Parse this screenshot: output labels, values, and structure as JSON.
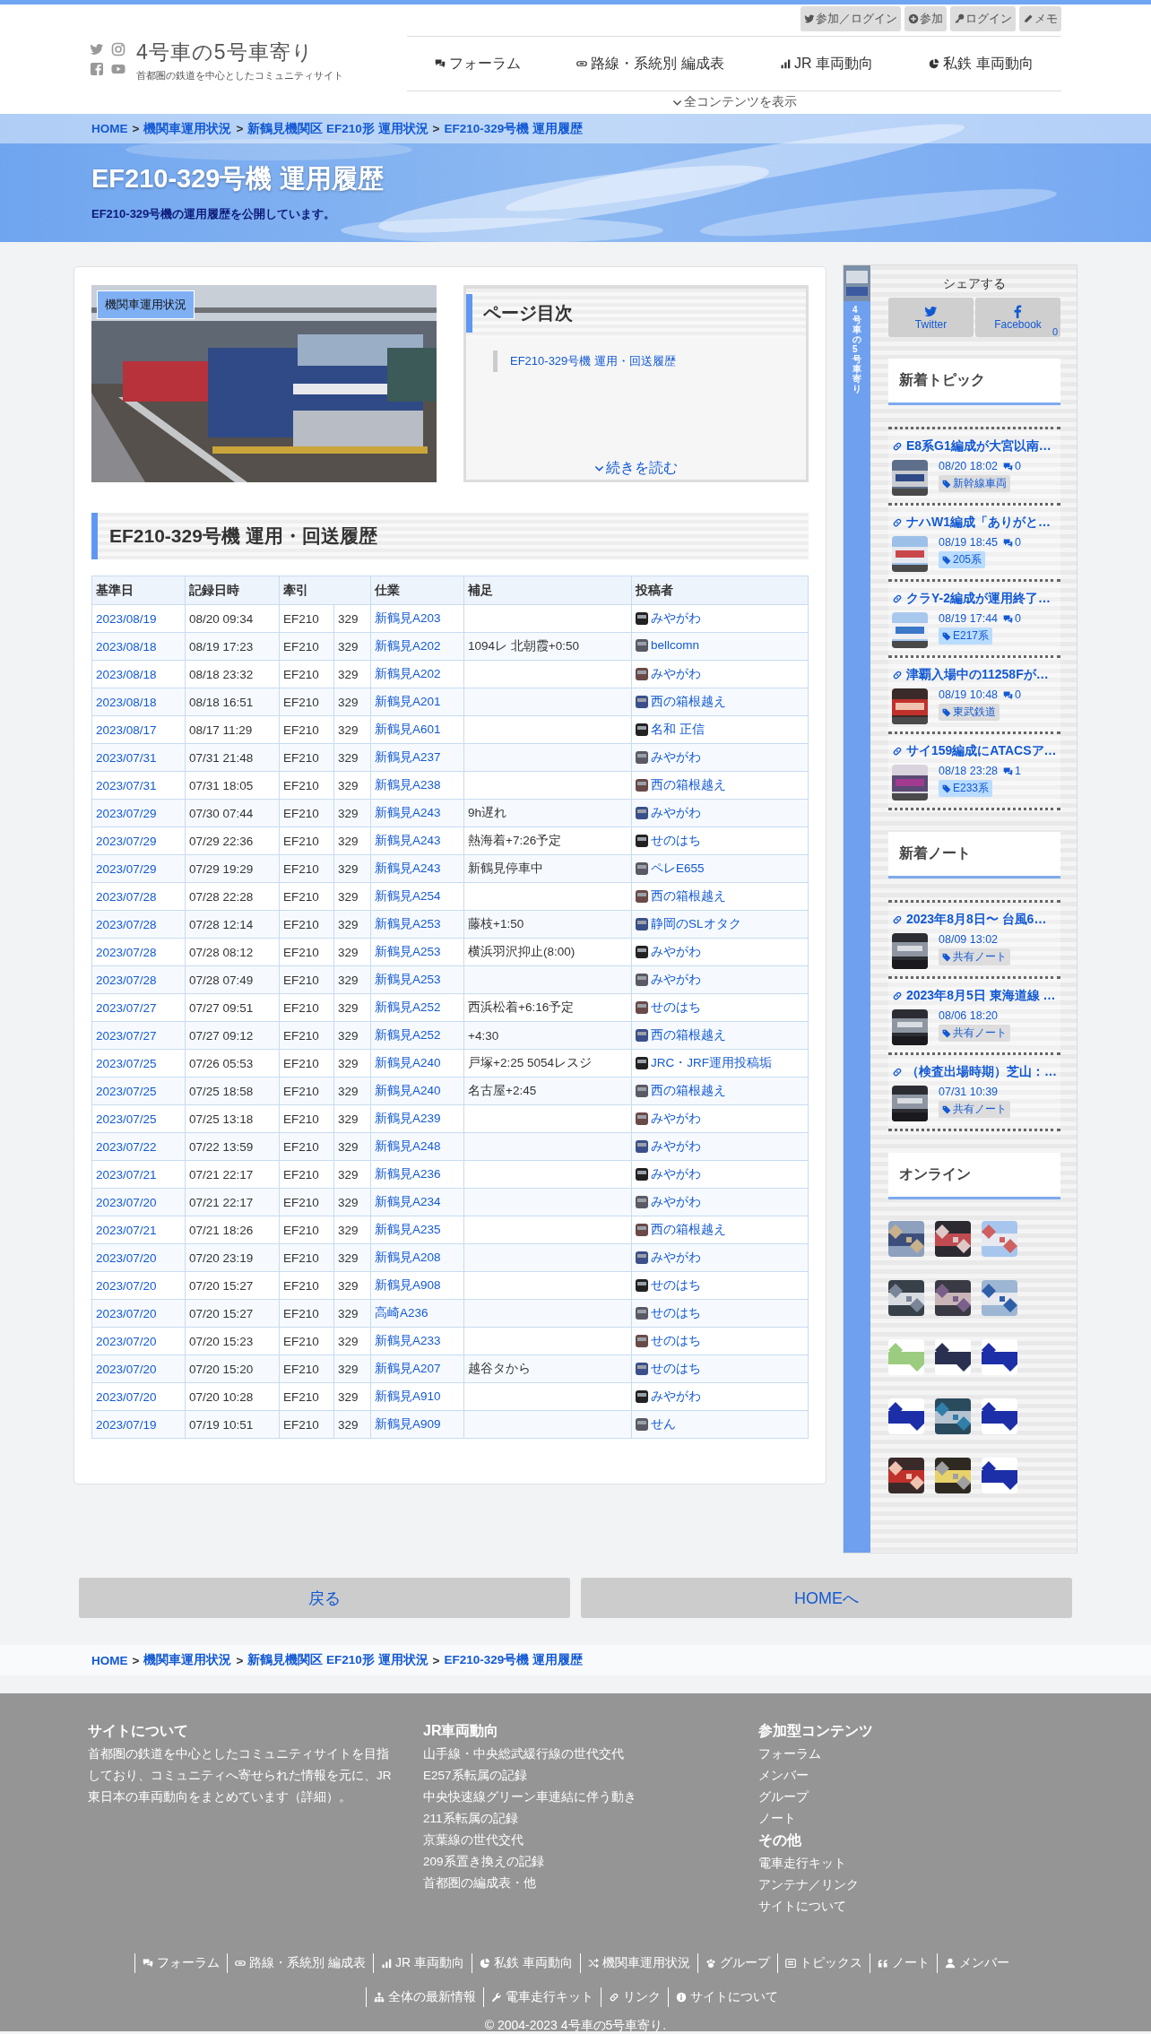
{
  "header": {
    "site_title": "4号車の5号車寄り",
    "tagline": "首都圏の鉄道を中心としたコミュニティサイト",
    "user_links": [
      "参加／ログイン",
      "参加",
      "ログイン",
      "メモ"
    ],
    "nav": [
      "フォーラム",
      "路線・系統別 編成表",
      "JR 車両動向",
      "私鉄 車両動向"
    ],
    "show_all": "全コンテンツを表示"
  },
  "breadcrumb": {
    "separator": ">",
    "items": [
      "HOME",
      "機関車運用状況",
      "新鶴見機関区 EF210形 運用状況",
      "EF210-329号機 運用履歴"
    ]
  },
  "hero": {
    "title": "EF210-329号機 運用履歴",
    "subtitle": "EF210-329号機の運用履歴を公開しています。"
  },
  "photo": {
    "kind": "picture",
    "tag": "機関車運用状況"
  },
  "toc": {
    "title": "ページ目次",
    "items": [
      "EF210-329号機 運用・回送履歴"
    ],
    "more": "続きを読む"
  },
  "section_title": "EF210-329号機 運用・回送履歴",
  "table": {
    "columns": [
      "基準日",
      "記録日時",
      "牽引",
      "仕業",
      "補足",
      "投稿者"
    ],
    "rows": [
      {
        "date": "2023/08/19",
        "recorded": "08/20 09:34",
        "loco": "EF210",
        "number": "329",
        "duty": "新鶴見A203",
        "poster": "みやがわ"
      },
      {
        "date": "2023/08/18",
        "recorded": "08/19 17:23",
        "loco": "EF210",
        "number": "329",
        "duty": "新鶴見A202",
        "note": "1094レ 北朝霞+0:50",
        "poster": "bellcomn"
      },
      {
        "date": "2023/08/18",
        "recorded": "08/18 23:32",
        "loco": "EF210",
        "number": "329",
        "duty": "新鶴見A202",
        "poster": "みやがわ"
      },
      {
        "date": "2023/08/18",
        "recorded": "08/18 16:51",
        "loco": "EF210",
        "number": "329",
        "duty": "新鶴見A201",
        "poster": "西の箱根越え"
      },
      {
        "date": "2023/08/17",
        "recorded": "08/17 11:29",
        "loco": "EF210",
        "number": "329",
        "duty": "新鶴見A601",
        "poster": "名和 正信"
      },
      {
        "date": "2023/07/31",
        "recorded": "07/31 21:48",
        "loco": "EF210",
        "number": "329",
        "duty": "新鶴見A237",
        "poster": "みやがわ"
      },
      {
        "date": "2023/07/31",
        "recorded": "07/31 18:05",
        "loco": "EF210",
        "number": "329",
        "duty": "新鶴見A238",
        "poster": "西の箱根越え"
      },
      {
        "date": "2023/07/29",
        "recorded": "07/30 07:44",
        "loco": "EF210",
        "number": "329",
        "duty": "新鶴見A243",
        "note": "9h遅れ",
        "poster": "みやがわ"
      },
      {
        "date": "2023/07/29",
        "recorded": "07/29 22:36",
        "loco": "EF210",
        "number": "329",
        "duty": "新鶴見A243",
        "note": "熱海着+7:26予定",
        "poster": "せのはち"
      },
      {
        "date": "2023/07/29",
        "recorded": "07/29 19:29",
        "loco": "EF210",
        "number": "329",
        "duty": "新鶴見A243",
        "note": "新鶴見停車中",
        "poster": "ペレE655"
      },
      {
        "date": "2023/07/28",
        "recorded": "07/28 22:28",
        "loco": "EF210",
        "number": "329",
        "duty": "新鶴見A254",
        "poster": "西の箱根越え"
      },
      {
        "date": "2023/07/28",
        "recorded": "07/28 12:14",
        "loco": "EF210",
        "number": "329",
        "duty": "新鶴見A253",
        "note": "藤枝+1:50",
        "poster": "静岡のSLオタク"
      },
      {
        "date": "2023/07/28",
        "recorded": "07/28 08:12",
        "loco": "EF210",
        "number": "329",
        "duty": "新鶴見A253",
        "note": "横浜羽沢抑止(8:00)",
        "poster": "みやがわ"
      },
      {
        "date": "2023/07/28",
        "recorded": "07/28 07:49",
        "loco": "EF210",
        "number": "329",
        "duty": "新鶴見A253",
        "poster": "みやがわ"
      },
      {
        "date": "2023/07/27",
        "recorded": "07/27 09:51",
        "loco": "EF210",
        "number": "329",
        "duty": "新鶴見A252",
        "note": "西浜松着+6:16予定",
        "poster": "せのはち"
      },
      {
        "date": "2023/07/27",
        "recorded": "07/27 09:12",
        "loco": "EF210",
        "number": "329",
        "duty": "新鶴見A252",
        "note": "+4:30",
        "poster": "西の箱根越え"
      },
      {
        "date": "2023/07/25",
        "recorded": "07/26 05:53",
        "loco": "EF210",
        "number": "329",
        "duty": "新鶴見A240",
        "note": "戸塚+2:25 5054レスジ",
        "poster": "JRC・JRF運用投稿垢"
      },
      {
        "date": "2023/07/25",
        "recorded": "07/25 18:58",
        "loco": "EF210",
        "number": "329",
        "duty": "新鶴見A240",
        "note": "名古屋+2:45",
        "poster": "西の箱根越え"
      },
      {
        "date": "2023/07/25",
        "recorded": "07/25 13:18",
        "loco": "EF210",
        "number": "329",
        "duty": "新鶴見A239",
        "poster": "みやがわ"
      },
      {
        "date": "2023/07/22",
        "recorded": "07/22 13:59",
        "loco": "EF210",
        "number": "329",
        "duty": "新鶴見A248",
        "poster": "みやがわ"
      },
      {
        "date": "2023/07/21",
        "recorded": "07/21 22:17",
        "loco": "EF210",
        "number": "329",
        "duty": "新鶴見A236",
        "poster": "みやがわ"
      },
      {
        "date": "2023/07/20",
        "recorded": "07/21 22:17",
        "loco": "EF210",
        "number": "329",
        "duty": "新鶴見A234",
        "poster": "みやがわ"
      },
      {
        "date": "2023/07/21",
        "recorded": "07/21 18:26",
        "loco": "EF210",
        "number": "329",
        "duty": "新鶴見A235",
        "poster": "西の箱根越え"
      },
      {
        "date": "2023/07/20",
        "recorded": "07/20 23:19",
        "loco": "EF210",
        "number": "329",
        "duty": "新鶴見A208",
        "poster": "みやがわ"
      },
      {
        "date": "2023/07/20",
        "recorded": "07/20 15:27",
        "loco": "EF210",
        "number": "329",
        "duty": "新鶴見A908",
        "poster": "せのはち"
      },
      {
        "date": "2023/07/20",
        "recorded": "07/20 15:27",
        "loco": "EF210",
        "number": "329",
        "duty": "高崎A236",
        "poster": "せのはち"
      },
      {
        "date": "2023/07/20",
        "recorded": "07/20 15:23",
        "loco": "EF210",
        "number": "329",
        "duty": "新鶴見A233",
        "poster": "せのはち"
      },
      {
        "date": "2023/07/20",
        "recorded": "07/20 15:20",
        "loco": "EF210",
        "number": "329",
        "duty": "新鶴見A207",
        "note": "越谷タから",
        "poster": "せのはち"
      },
      {
        "date": "2023/07/20",
        "recorded": "07/20 10:28",
        "loco": "EF210",
        "number": "329",
        "duty": "新鶴見A910",
        "poster": "みやがわ"
      },
      {
        "date": "2023/07/19",
        "recorded": "07/19 10:51",
        "loco": "EF210",
        "number": "329",
        "duty": "新鶴見A909",
        "poster": "せん"
      }
    ]
  },
  "sidebar": {
    "strip_text": "4号車の5号車寄り",
    "share_title": "シェアする",
    "share": [
      {
        "label": "Twitter"
      },
      {
        "label": "Facebook",
        "count": "0"
      }
    ],
    "topics": {
      "title": "新着トピック",
      "items": [
        {
          "title": "E8系G1編成が大宮以南…",
          "time": "08/20 18:02",
          "comments": "0",
          "tag": "新幹線車両",
          "color": "#dddddd"
        },
        {
          "title": "ナハW1編成「ありがと…",
          "time": "08/19 18:45",
          "comments": "0",
          "tag": "205系",
          "color": "#b9dcff"
        },
        {
          "title": "クラY-2編成が運用終了…",
          "time": "08/19 17:44",
          "comments": "0",
          "tag": "E217系",
          "color": "#b9dcff"
        },
        {
          "title": "津覇入場中の11258Fが…",
          "time": "08/19 10:48",
          "comments": "0",
          "tag": "東武鉄道",
          "color": "#dddddd"
        },
        {
          "title": "サイ159編成にATACSア…",
          "time": "08/18 23:28",
          "comments": "1",
          "tag": "E233系",
          "color": "#b9dcff"
        }
      ]
    },
    "notes": {
      "title": "新着ノート",
      "items": [
        {
          "title": "2023年8月8日〜 台風6…",
          "time": "08/09 13:02",
          "tag": "共有ノート",
          "color": "#dddddd"
        },
        {
          "title": "2023年8月5日 東海道線 …",
          "time": "08/06 18:20",
          "tag": "共有ノート",
          "color": "#dddddd"
        },
        {
          "title": "（検査出場時期）芝山：…",
          "time": "07/31 10:39",
          "tag": "共有ノート",
          "color": "#dddddd"
        }
      ]
    },
    "online": {
      "title": "オンライン"
    }
  },
  "bottom_buttons": [
    "戻る",
    "HOMEへ"
  ],
  "footer_breadcrumb": {
    "separator": ">",
    "items": [
      "HOME",
      "機関車運用状況",
      "新鶴見機関区 EF210形 運用状況",
      "EF210-329号機 運用履歴"
    ]
  },
  "footer": {
    "columns": [
      {
        "title": "サイトについて",
        "text": "首都圏の鉄道を中心としたコミュニティサイトを目指しており、コミュニティへ寄せられた情報を元に、JR東日本の車両動向をまとめています（詳細）。"
      },
      {
        "title": "JR車両動向",
        "links": [
          "山手線・中央総武緩行線の世代交代",
          "E257系転属の記録",
          "中央快速線グリーン車連結に伴う動き",
          "211系転属の記録",
          "京葉線の世代交代",
          "209系置き換えの記録",
          "首都圏の編成表・他"
        ]
      },
      {
        "title": "参加型コンテンツ",
        "links": [
          "フォーラム",
          "メンバー",
          "グループ",
          "ノート"
        ],
        "subtitle": "その他",
        "sublinks": [
          "電車走行キット",
          "アンテナ／リンク",
          "サイトについて"
        ]
      }
    ],
    "nav": [
      "フォーラム",
      "路線・系統別 編成表",
      "JR 車両動向",
      "私鉄 車両動向",
      "機関車運用状況",
      "グループ",
      "トピックス",
      "ノート",
      "メンバー",
      "全体の最新情報",
      "電車走行キット",
      "リンク",
      "サイトについて"
    ],
    "copyright": "© 2004-2023 4号車の5号車寄り."
  }
}
